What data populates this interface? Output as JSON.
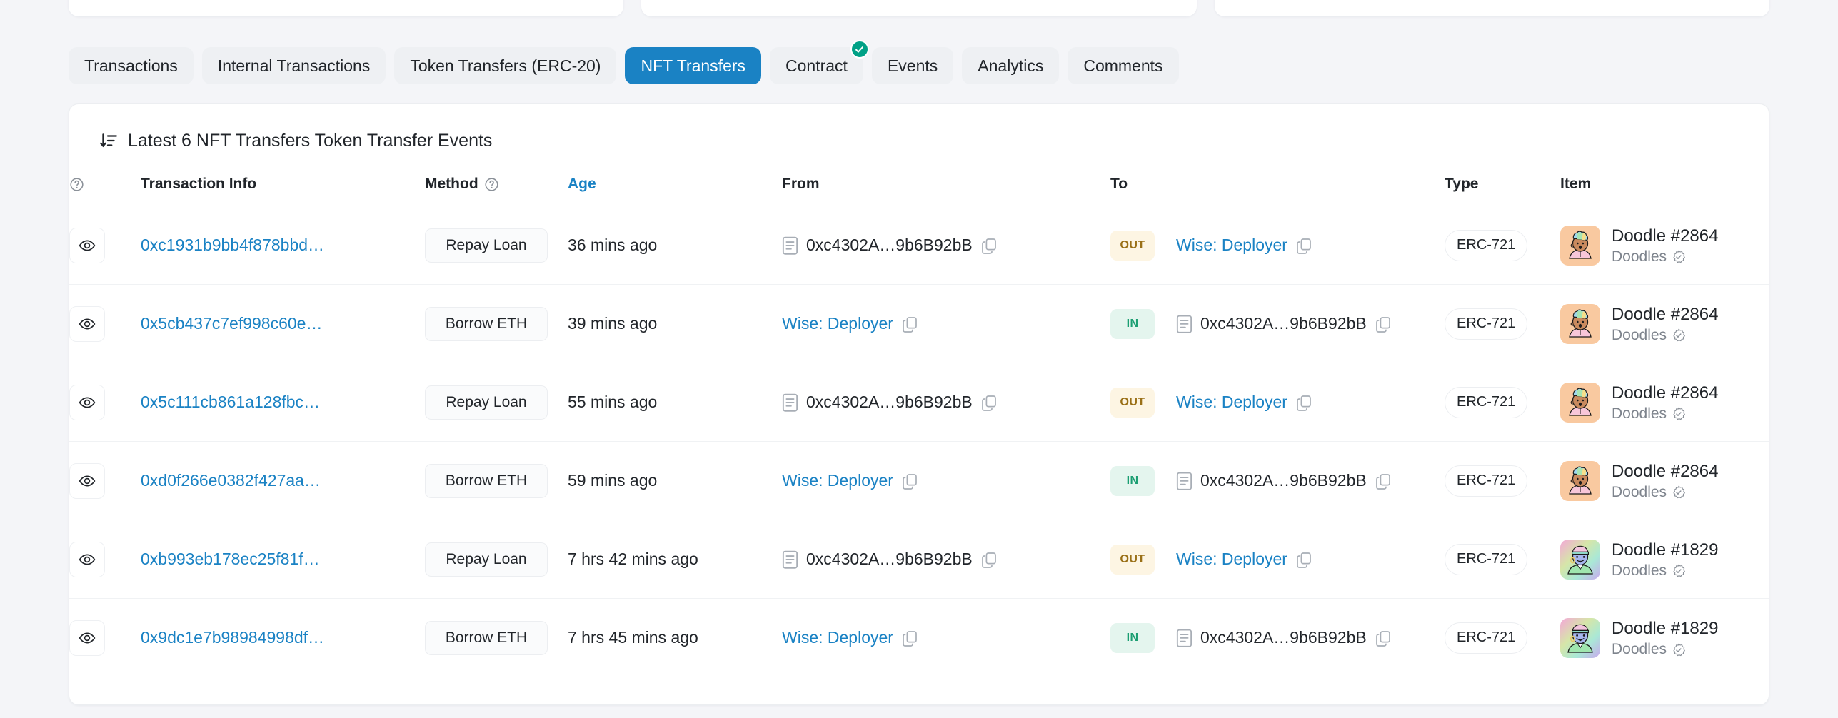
{
  "top_cards": [
    {
      "name": "overview-card"
    },
    {
      "name": "more-info-card"
    },
    {
      "name": "multichain-card"
    }
  ],
  "tabs": [
    {
      "label": "Transactions",
      "active": false,
      "badge": false
    },
    {
      "label": "Internal Transactions",
      "active": false,
      "badge": false
    },
    {
      "label": "Token Transfers (ERC-20)",
      "active": false,
      "badge": false
    },
    {
      "label": "NFT Transfers",
      "active": true,
      "badge": false
    },
    {
      "label": "Contract",
      "active": false,
      "badge": true,
      "badge_icon": "check-circle-icon"
    },
    {
      "label": "Events",
      "active": false,
      "badge": false
    },
    {
      "label": "Analytics",
      "active": false,
      "badge": false
    },
    {
      "label": "Comments",
      "active": false,
      "badge": false
    }
  ],
  "panel": {
    "sort_icon": "sort-descending-icon",
    "title": "Latest 6 NFT Transfers Token Transfer Events"
  },
  "table": {
    "columns": {
      "eye": "",
      "txn": "Transaction Info",
      "method": "Method",
      "age": "Age",
      "from": "From",
      "to": "To",
      "type": "Type",
      "item": "Item"
    },
    "rows": [
      {
        "eye_icon": "eye-icon",
        "txn_hash": "0xc1931b9bb4f878bbd…",
        "method": "Repay Loan",
        "age": "36 mins ago",
        "from": {
          "kind": "address",
          "icon": "contract-icon",
          "text": "0xc4302A…9b6B92bB",
          "copy_icon": "copy-icon"
        },
        "direction": "OUT",
        "to": {
          "kind": "label",
          "text": "Wise: Deployer",
          "copy_icon": "copy-icon"
        },
        "type": "ERC-721",
        "item": {
          "name": "Doodle #2864",
          "collection": "Doodles",
          "verified_icon": "verified-icon",
          "art": "doodle-2864"
        }
      },
      {
        "eye_icon": "eye-icon",
        "txn_hash": "0x5cb437c7ef998c60e…",
        "method": "Borrow ETH",
        "age": "39 mins ago",
        "from": {
          "kind": "label",
          "text": "Wise: Deployer",
          "copy_icon": "copy-icon"
        },
        "direction": "IN",
        "to": {
          "kind": "address",
          "icon": "contract-icon",
          "text": "0xc4302A…9b6B92bB",
          "copy_icon": "copy-icon"
        },
        "type": "ERC-721",
        "item": {
          "name": "Doodle #2864",
          "collection": "Doodles",
          "verified_icon": "verified-icon",
          "art": "doodle-2864"
        }
      },
      {
        "eye_icon": "eye-icon",
        "txn_hash": "0x5c111cb861a128fbc…",
        "method": "Repay Loan",
        "age": "55 mins ago",
        "from": {
          "kind": "address",
          "icon": "contract-icon",
          "text": "0xc4302A…9b6B92bB",
          "copy_icon": "copy-icon"
        },
        "direction": "OUT",
        "to": {
          "kind": "label",
          "text": "Wise: Deployer",
          "copy_icon": "copy-icon"
        },
        "type": "ERC-721",
        "item": {
          "name": "Doodle #2864",
          "collection": "Doodles",
          "verified_icon": "verified-icon",
          "art": "doodle-2864"
        }
      },
      {
        "eye_icon": "eye-icon",
        "txn_hash": "0xd0f266e0382f427aa…",
        "method": "Borrow ETH",
        "age": "59 mins ago",
        "from": {
          "kind": "label",
          "text": "Wise: Deployer",
          "copy_icon": "copy-icon"
        },
        "direction": "IN",
        "to": {
          "kind": "address",
          "icon": "contract-icon",
          "text": "0xc4302A…9b6B92bB",
          "copy_icon": "copy-icon"
        },
        "type": "ERC-721",
        "item": {
          "name": "Doodle #2864",
          "collection": "Doodles",
          "verified_icon": "verified-icon",
          "art": "doodle-2864"
        }
      },
      {
        "eye_icon": "eye-icon",
        "txn_hash": "0xb993eb178ec25f81f…",
        "method": "Repay Loan",
        "age": "7 hrs 42 mins ago",
        "from": {
          "kind": "address",
          "icon": "contract-icon",
          "text": "0xc4302A…9b6B92bB",
          "copy_icon": "copy-icon"
        },
        "direction": "OUT",
        "to": {
          "kind": "label",
          "text": "Wise: Deployer",
          "copy_icon": "copy-icon"
        },
        "type": "ERC-721",
        "item": {
          "name": "Doodle #1829",
          "collection": "Doodles",
          "verified_icon": "verified-icon",
          "art": "doodle-1829"
        }
      },
      {
        "eye_icon": "eye-icon",
        "txn_hash": "0x9dc1e7b98984998df…",
        "method": "Borrow ETH",
        "age": "7 hrs 45 mins ago",
        "from": {
          "kind": "label",
          "text": "Wise: Deployer",
          "copy_icon": "copy-icon"
        },
        "direction": "IN",
        "to": {
          "kind": "address",
          "icon": "contract-icon",
          "text": "0xc4302A…9b6B92bB",
          "copy_icon": "copy-icon"
        },
        "type": "ERC-721",
        "item": {
          "name": "Doodle #1829",
          "collection": "Doodles",
          "verified_icon": "verified-icon",
          "art": "doodle-1829"
        }
      }
    ]
  },
  "colors": {
    "accent": "#1a82c4",
    "page_bg": "#f4f5f8",
    "card_bg": "#ffffff",
    "out_badge_bg": "#fdf5e3",
    "out_badge_fg": "#9a7017",
    "in_badge_bg": "#e4f5ee",
    "in_badge_fg": "#1b9e72",
    "verified_badge": "#00a186",
    "muted_text": "#7d838c"
  }
}
